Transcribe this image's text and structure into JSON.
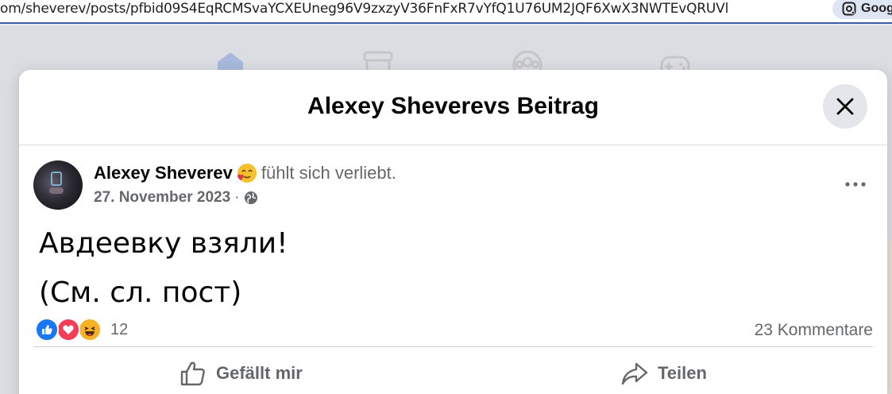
{
  "browser": {
    "url": "om/sheverev/posts/pfbid09S4EqRCMSvaYCXEUneg96V9zxzyV36FnFxR7vYfQ1U76UM2JQF6XwX3NWTEvQRUVl",
    "lens_label": "Goog"
  },
  "modal": {
    "title": "Alexey Sheverevs Beitrag"
  },
  "post": {
    "author": "Alexey Sheverev",
    "feeling": "fühlt sich verliebt.",
    "date": "27. November 2023",
    "separator": "·",
    "text_lines": [
      "Авдеевку взяли!",
      "(См. сл. пост)"
    ],
    "reaction_count": "12",
    "comments": "23 Kommentare"
  },
  "actions": {
    "like_label": "Gefällt mir",
    "share_label": "Teilen"
  },
  "colors": {
    "accent": "#1877f2",
    "love": "#f33e58",
    "haha": "#f7b125",
    "secondary_text": "#65676b"
  },
  "icons": [
    "google-lens-icon",
    "home-icon",
    "marketplace-icon",
    "groups-icon",
    "gaming-icon",
    "close-icon",
    "emoji-in-love-icon",
    "globe-icon",
    "more-icon",
    "like-reaction-icon",
    "love-reaction-icon",
    "haha-reaction-icon",
    "thumbs-up-icon",
    "share-icon"
  ]
}
